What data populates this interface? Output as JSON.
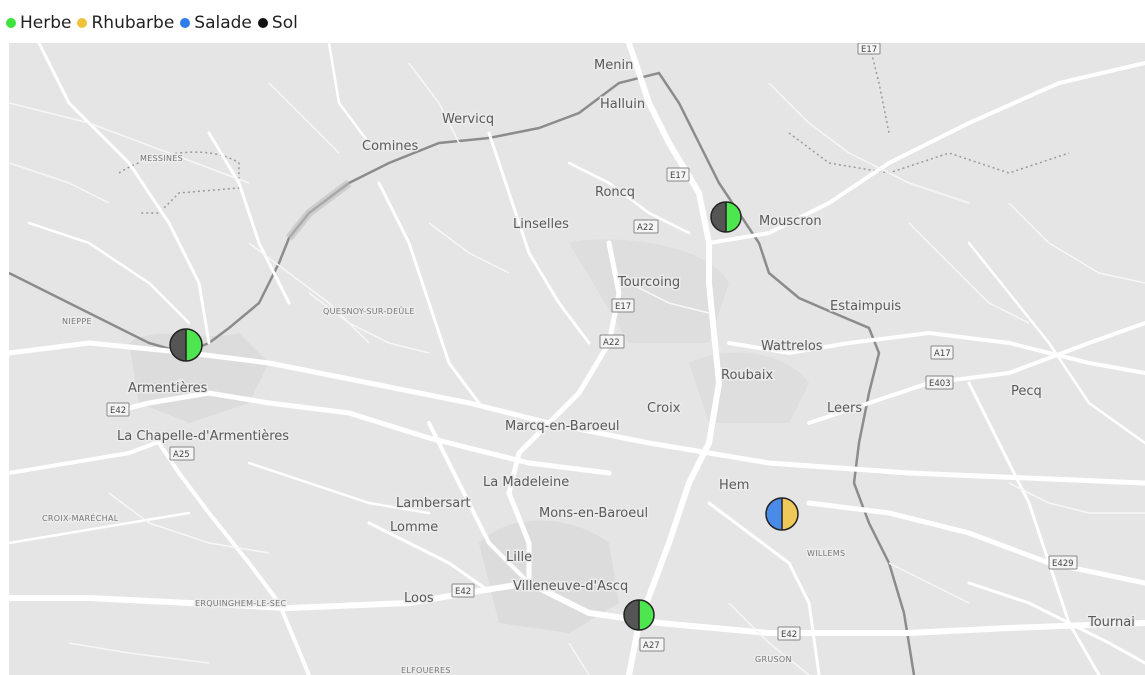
{
  "legend": [
    {
      "label": "Herbe",
      "color": "#3ee43e"
    },
    {
      "label": "Rhubarbe",
      "color": "#efc23a"
    },
    {
      "label": "Salade",
      "color": "#2f7bea"
    },
    {
      "label": "Sol",
      "color": "#111111"
    }
  ],
  "colors": {
    "sol_marker": "#555555",
    "herbe_marker": "#4ee64e",
    "rhubarbe_marker": "#eec95a",
    "salade_marker": "#4a8ae8",
    "map_bg": "#e5e5e5",
    "road": "#ffffff"
  },
  "places": [
    {
      "name": "Menin",
      "size": "big"
    },
    {
      "name": "Halluin",
      "size": "big"
    },
    {
      "name": "Wervicq",
      "size": "big"
    },
    {
      "name": "Comines",
      "size": "big"
    },
    {
      "name": "MESSINES",
      "size": "small"
    },
    {
      "name": "Roncq",
      "size": "big"
    },
    {
      "name": "Linselles",
      "size": "big"
    },
    {
      "name": "Mouscron",
      "size": "big"
    },
    {
      "name": "Tourcoing",
      "size": "big"
    },
    {
      "name": "Estaimpuis",
      "size": "big"
    },
    {
      "name": "NIEPPE",
      "size": "small"
    },
    {
      "name": "QUESNOY-SUR-DEÛLE",
      "size": "small"
    },
    {
      "name": "Wattrelos",
      "size": "big"
    },
    {
      "name": "Roubaix",
      "size": "big"
    },
    {
      "name": "Armentières",
      "size": "big"
    },
    {
      "name": "Pecq",
      "size": "big"
    },
    {
      "name": "Croix",
      "size": "big"
    },
    {
      "name": "Leers",
      "size": "big"
    },
    {
      "name": "La Chapelle-d'Armentières",
      "size": "big"
    },
    {
      "name": "Marcq-en-Baroeul",
      "size": "big"
    },
    {
      "name": "La Madeleine",
      "size": "big"
    },
    {
      "name": "Hem",
      "size": "big"
    },
    {
      "name": "Lambersart",
      "size": "big"
    },
    {
      "name": "CROIX-MARÉCHAL",
      "size": "small"
    },
    {
      "name": "Mons-en-Baroeul",
      "size": "big"
    },
    {
      "name": "Lomme",
      "size": "big"
    },
    {
      "name": "WILLEMS",
      "size": "small"
    },
    {
      "name": "Lille",
      "size": "big"
    },
    {
      "name": "Villeneuve-d'Ascq",
      "size": "big"
    },
    {
      "name": "Loos",
      "size": "big"
    },
    {
      "name": "ERQUINGHEM-LE-SEC",
      "size": "small"
    },
    {
      "name": "Tournai",
      "size": "big"
    },
    {
      "name": "GRUSON",
      "size": "small"
    },
    {
      "name": "ELFOUERES",
      "size": "small"
    }
  ],
  "road_shields": [
    "E17",
    "E17",
    "A22",
    "E17",
    "A22",
    "A17",
    "E403",
    "E42",
    "A25",
    "E42",
    "E429",
    "E42",
    "A27"
  ],
  "markers": [
    {
      "location": "Mouscron",
      "series": [
        "Sol",
        "Herbe"
      ]
    },
    {
      "location": "Armentières",
      "series": [
        "Sol",
        "Herbe"
      ]
    },
    {
      "location": "Willems",
      "series": [
        "Salade",
        "Rhubarbe"
      ]
    },
    {
      "location": "Villeneuve-d'Ascq",
      "series": [
        "Sol",
        "Herbe"
      ]
    }
  ]
}
